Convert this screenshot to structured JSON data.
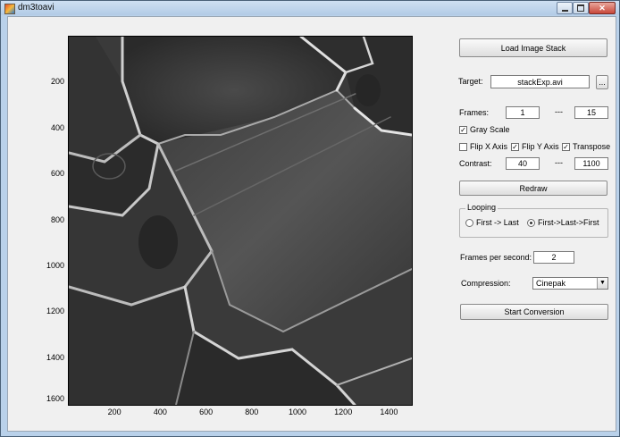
{
  "window": {
    "title": "dm3toavi",
    "close_glyph": "✕"
  },
  "axes": {
    "x_ticks": [
      "200",
      "400",
      "600",
      "800",
      "1000",
      "1200",
      "1400"
    ],
    "x_tick_values": [
      200,
      400,
      600,
      800,
      1000,
      1200,
      1400
    ],
    "x_range": [
      0,
      1500
    ],
    "y_ticks": [
      "200",
      "400",
      "600",
      "800",
      "1000",
      "1200",
      "1400",
      "1600"
    ],
    "y_tick_values": [
      200,
      400,
      600,
      800,
      1000,
      1200,
      1400,
      1600
    ],
    "y_range": [
      0,
      1600
    ]
  },
  "controls": {
    "load_button": "Load Image Stack",
    "target_label": "Target:",
    "target_value": "stackExp.avi",
    "browse_button": "...",
    "frames_label": "Frames:",
    "frames_start": "1",
    "frames_sep": "---",
    "frames_end": "15",
    "gray_scale_label": "Gray Scale",
    "gray_scale_checked": true,
    "flip_x_label": "Flip X Axis",
    "flip_x_checked": false,
    "flip_y_label": "Flip Y Axis",
    "flip_y_checked": true,
    "transpose_label": "Transpose",
    "transpose_checked": true,
    "contrast_label": "Contrast:",
    "contrast_min": "40",
    "contrast_sep": "---",
    "contrast_max": "1100",
    "redraw_button": "Redraw",
    "looping_title": "Looping",
    "loop_option_1": "First -> Last",
    "loop_option_2": "First->Last->First",
    "loop_selected": 2,
    "fps_label": "Frames per second:",
    "fps_value": "2",
    "compression_label": "Compression:",
    "compression_value": "Cinepak",
    "start_button": "Start Conversion",
    "check_glyph": "✓",
    "dropdown_glyph": "▼"
  }
}
